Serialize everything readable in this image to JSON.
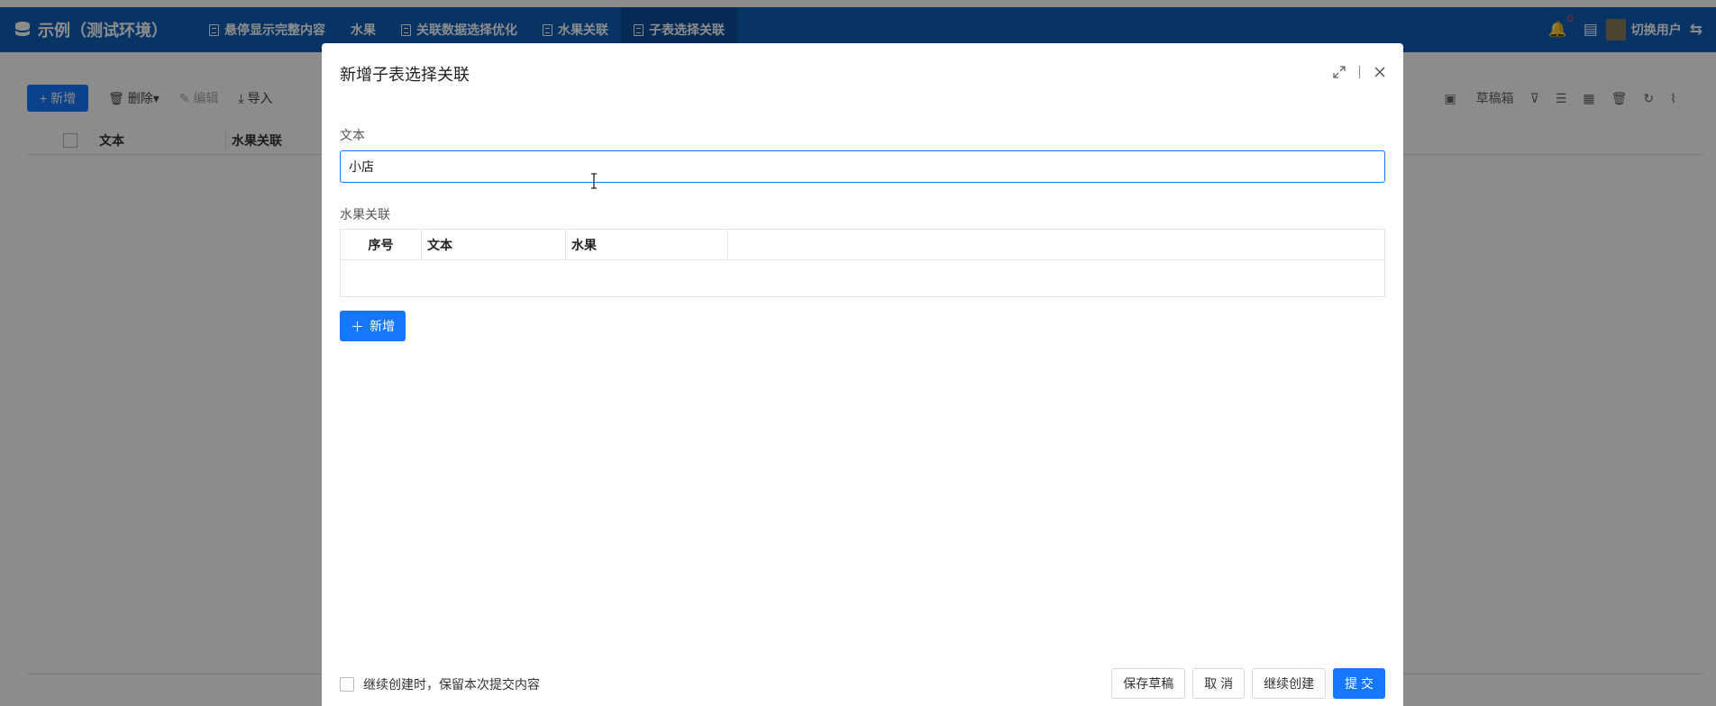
{
  "app": {
    "title": "示例（测试环境）",
    "tabs": [
      {
        "label": "悬停显示完整内容",
        "icon": "document-icon"
      },
      {
        "label": "水果",
        "icon": ""
      },
      {
        "label": "关联数据选择优化",
        "icon": "document-icon"
      },
      {
        "label": "水果关联",
        "icon": "document-icon"
      },
      {
        "label": "子表选择关联",
        "icon": "document-icon",
        "active": true
      }
    ],
    "user_label": "切换用户"
  },
  "toolbar": {
    "add_label": "+ 新增",
    "delete_label": "删除",
    "edit_label": "编辑",
    "import_label": "导入",
    "drafts_label": "草稿箱"
  },
  "grid": {
    "columns": [
      "文本",
      "水果关联"
    ]
  },
  "modal": {
    "title": "新增子表选择关联",
    "text_field": {
      "label": "文本",
      "value": "小店"
    },
    "subtable": {
      "label": "水果关联",
      "columns": [
        "序号",
        "文本",
        "水果"
      ]
    },
    "add_row_label": "新增",
    "keep_content_label": "继续创建时，保留本次提交内容",
    "save_draft_label": "保存草稿",
    "cancel_label": "取 消",
    "continue_label": "继续创建",
    "submit_label": "提 交"
  },
  "colors": {
    "nav_bg": "#0d5fb8",
    "primary": "#1677ff"
  }
}
